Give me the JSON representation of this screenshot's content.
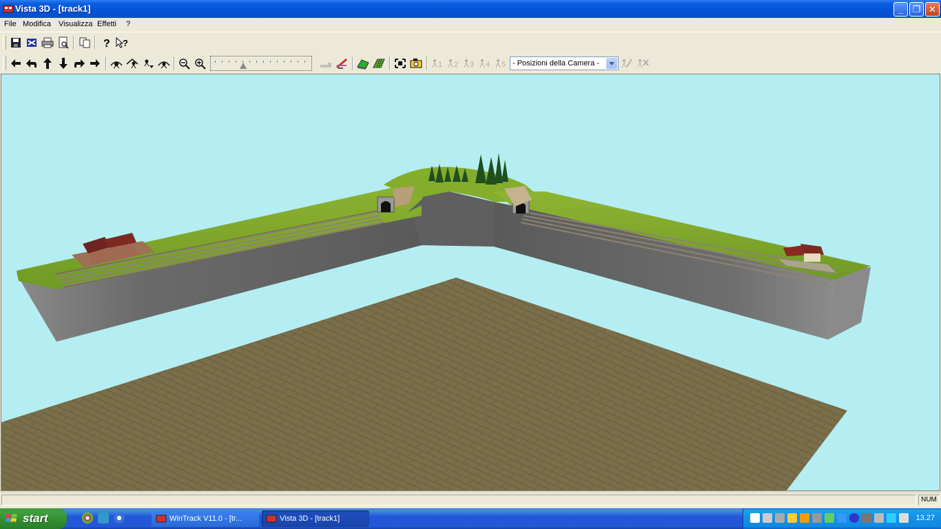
{
  "window": {
    "title": "Vista 3D - [track1]"
  },
  "caption_buttons": {
    "minimize": "_",
    "restore": "❐",
    "close": "✕"
  },
  "menu": {
    "items": [
      "File",
      "Modifica",
      "Visualizza",
      "Effetti",
      "?"
    ]
  },
  "toolbar2": {
    "camera_select": {
      "value": "- Posizioni della Camera -"
    }
  },
  "camera_positions": [
    "1",
    "2",
    "3",
    "4",
    "5"
  ],
  "statusbar": {
    "num": "NUM"
  },
  "taskbar": {
    "start_label": "start",
    "tasks": [
      "WinTrack  V11.0 - [tr...",
      "Vista 3D - [track1]"
    ],
    "clock": "13.27"
  },
  "colors": {
    "sky": "#b4eef2",
    "grass": "#7fa52d",
    "wall": "#6e6e6e",
    "floor": "#7a6e4a",
    "titlebar": "#0453d6"
  }
}
